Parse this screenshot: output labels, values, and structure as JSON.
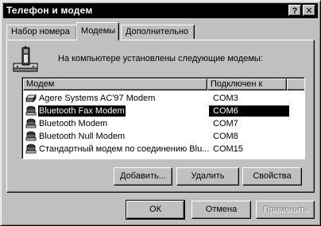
{
  "window": {
    "title": "Телефон и модем",
    "help_button": "?",
    "close_button": "✕"
  },
  "tabs": [
    {
      "label": "Набор номера",
      "active": false
    },
    {
      "label": "Модемы",
      "active": true
    },
    {
      "label": "Дополнительно",
      "active": false
    }
  ],
  "modems_tab": {
    "description": "На компьютере установлены следующие модемы:",
    "columns": [
      "Модем",
      "Подключен к"
    ],
    "rows": [
      {
        "name": "Agere Systems AC'97 Modem",
        "port": "COM3",
        "icon": "modem-icon",
        "selected": false
      },
      {
        "name": "Bluetooth Fax Modem",
        "port": "COM6",
        "icon": "modem-icon",
        "selected": true
      },
      {
        "name": "Bluetooth Modem",
        "port": "COM7",
        "icon": "modem-icon",
        "selected": false
      },
      {
        "name": "Bluetooth Null Modem",
        "port": "COM8",
        "icon": "modem-icon",
        "selected": false
      },
      {
        "name": "Стандартный модем по соединению Blu...",
        "port": "COM15",
        "icon": "modem-icon",
        "selected": false
      }
    ],
    "buttons": {
      "add": "Добавить...",
      "remove": "Удалить",
      "properties": "Свойства"
    }
  },
  "footer": {
    "ok": "ОК",
    "cancel": "Отмена",
    "apply": "Применить",
    "apply_disabled": true
  },
  "colors": {
    "face": "#c0c0c0",
    "title_bar": "#000000",
    "selection": "#000000",
    "disabled_text": "#808080"
  }
}
